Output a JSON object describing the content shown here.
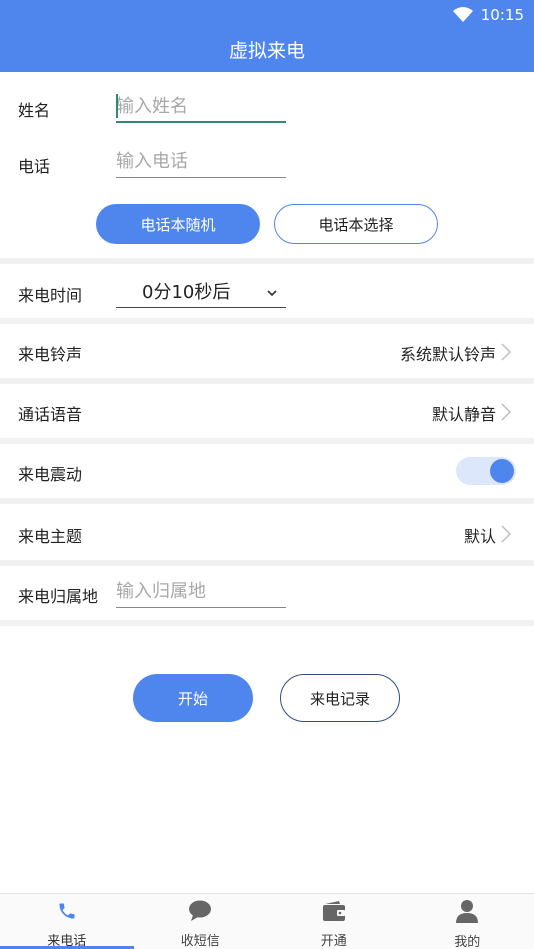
{
  "status_bar": {
    "time": "10:15"
  },
  "header": {
    "title": "虚拟来电"
  },
  "form": {
    "name_label": "姓名",
    "name_placeholder": "输入姓名",
    "name_value": "",
    "phone_label": "电话",
    "phone_placeholder": "输入电话",
    "phone_value": ""
  },
  "buttons": {
    "random_contact": "电话本随机",
    "pick_contact": "电话本选择",
    "start": "开始",
    "history": "来电记录"
  },
  "settings": {
    "call_time": {
      "label": "来电时间",
      "value": "0分10秒后"
    },
    "ringtone": {
      "label": "来电铃声",
      "value": "系统默认铃声"
    },
    "voice": {
      "label": "通话语音",
      "value": "默认静音"
    },
    "vibrate": {
      "label": "来电震动",
      "enabled": true
    },
    "theme": {
      "label": "来电主题",
      "value": "默认"
    },
    "location": {
      "label": "来电归属地",
      "placeholder": "输入归属地",
      "value": ""
    }
  },
  "tabbar": {
    "items": [
      {
        "label": "来电话",
        "icon": "phone-icon",
        "active": true
      },
      {
        "label": "收短信",
        "icon": "chat-bubble-icon",
        "active": false
      },
      {
        "label": "开通",
        "icon": "wallet-icon",
        "active": false
      },
      {
        "label": "我的",
        "icon": "person-icon",
        "active": false
      }
    ]
  },
  "colors": {
    "accent": "#4f86ee",
    "focus_line": "#2e8b7a",
    "divider": "#f1f1f1"
  }
}
